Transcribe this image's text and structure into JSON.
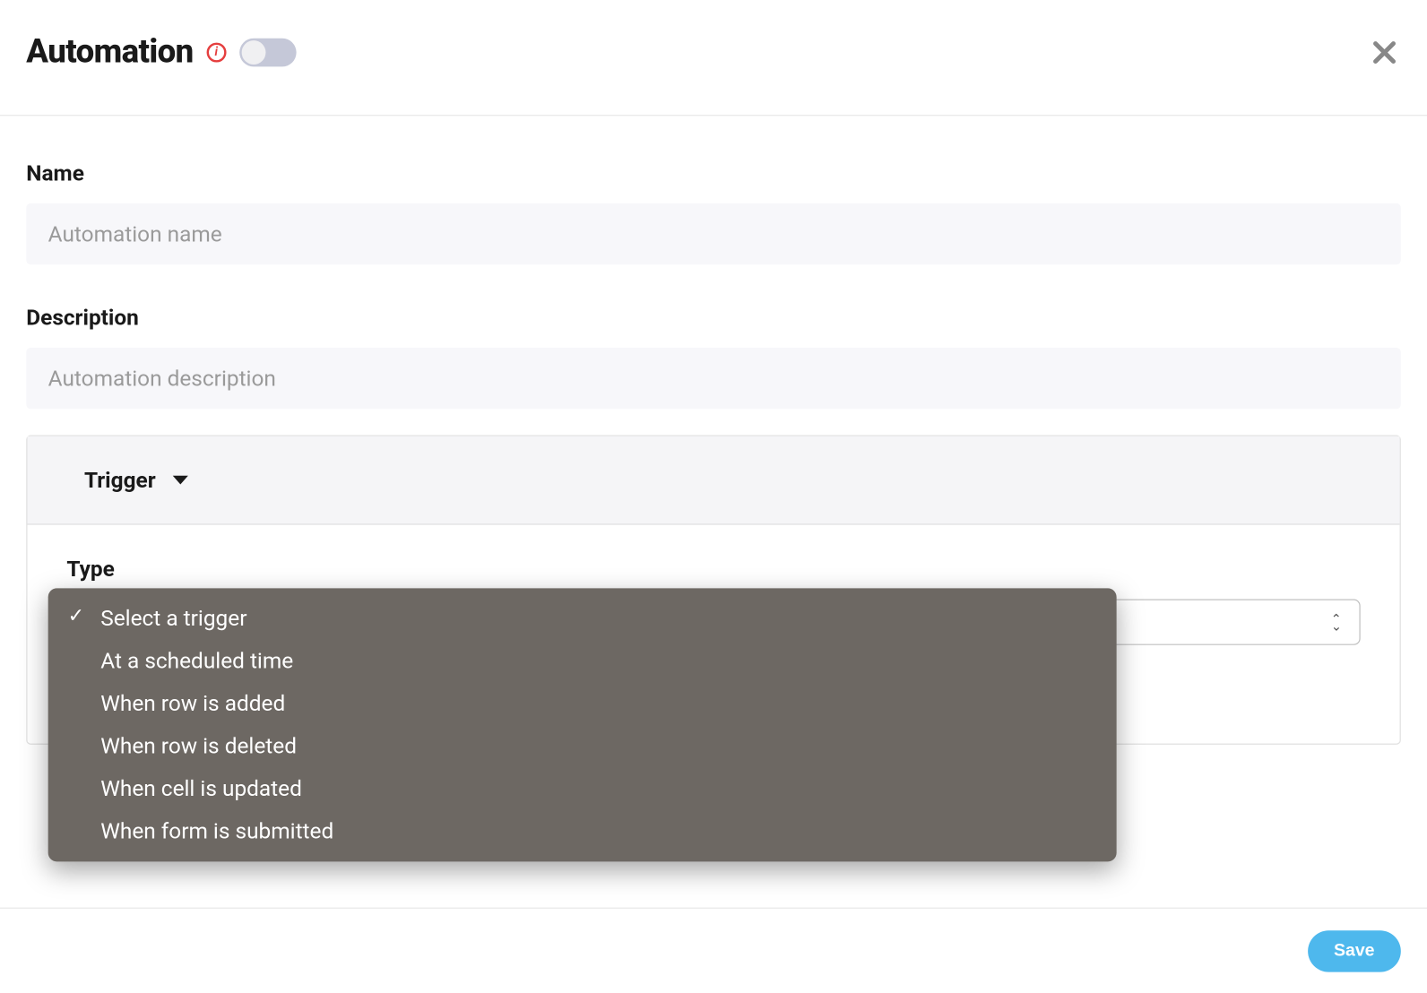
{
  "header": {
    "title": "Automation",
    "toggle_enabled": false,
    "info_icon": "info-icon",
    "close_icon": "close-icon"
  },
  "form": {
    "name": {
      "label": "Name",
      "placeholder": "Automation name",
      "value": ""
    },
    "description": {
      "label": "Description",
      "placeholder": "Automation description",
      "value": ""
    }
  },
  "trigger": {
    "panel_title": "Trigger",
    "type_label": "Type",
    "selected": "Select a trigger",
    "options": [
      "Select a trigger",
      "At a scheduled time",
      "When row is added",
      "When row is deleted",
      "When cell is updated",
      "When form is submitted"
    ]
  },
  "footer": {
    "save_label": "Save"
  }
}
